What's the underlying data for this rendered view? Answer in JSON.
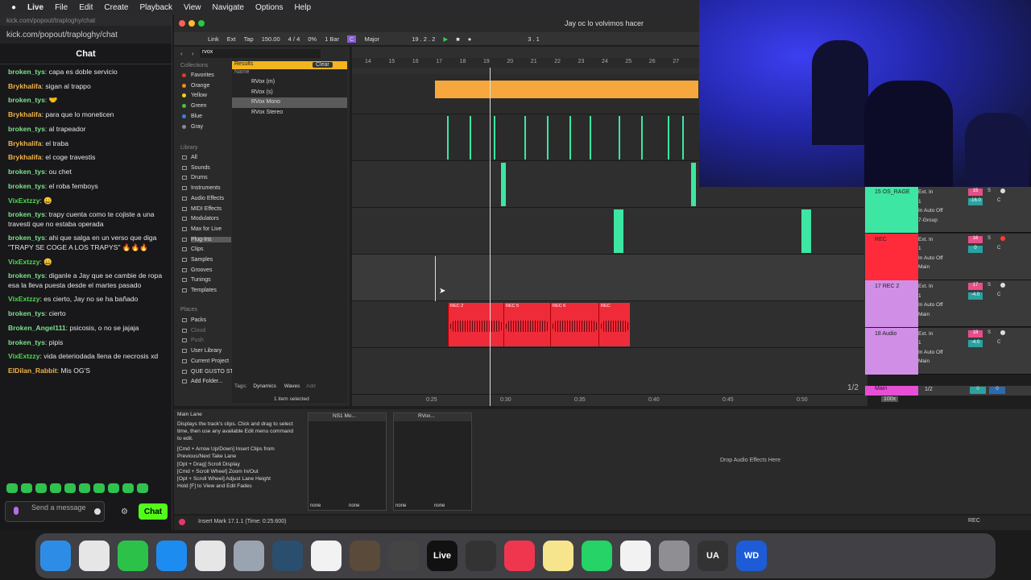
{
  "menubar": {
    "apple": "",
    "app": "Live",
    "items": [
      "File",
      "Edit",
      "Create",
      "Playback",
      "View",
      "Navigate",
      "Options",
      "Help"
    ]
  },
  "chat": {
    "window_title": "kick.com/popout/traploghy/chat",
    "url": "kick.com/popout/traploghy/chat",
    "header": "Chat",
    "messages": [
      {
        "user": "broken_tys",
        "text": "capa es doble servicio",
        "color": "#7ee08a"
      },
      {
        "user": "Brykhalifa",
        "text": "sigan al trappo",
        "color": "#f0b34a"
      },
      {
        "user": "broken_tys",
        "text": "🤝",
        "color": "#7ee08a"
      },
      {
        "user": "Brykhalifa",
        "text": "para que lo moneticen",
        "color": "#f0b34a"
      },
      {
        "user": "broken_tys",
        "text": "al trapeador",
        "color": "#7ee08a"
      },
      {
        "user": "Brykhalifa",
        "text": "el traba",
        "color": "#f0b34a"
      },
      {
        "user": "Brykhalifa",
        "text": "el coge travestis",
        "color": "#f0b34a"
      },
      {
        "user": "broken_tys",
        "text": "ou chet",
        "color": "#7ee08a"
      },
      {
        "user": "broken_tys",
        "text": "el roba femboys",
        "color": "#7ee08a"
      },
      {
        "user": "VixExtzzy",
        "text": "😀",
        "color": "#4fd94f"
      },
      {
        "user": "broken_tys",
        "text": "trapy cuenta como te cojiste a una travesti que no estaba operada",
        "color": "#7ee08a"
      },
      {
        "user": "broken_tys",
        "text": "ahi que salga en un verso que diga \"TRAPY SE COGE A LOS TRAPYS\" 🔥🔥🔥",
        "color": "#7ee08a"
      },
      {
        "user": "VixExtzzy",
        "text": "😀",
        "color": "#4fd94f"
      },
      {
        "user": "broken_tys",
        "text": "diganle a Jay que se cambie de ropa esa la lleva puesta desde el martes pasado",
        "color": "#7ee08a"
      },
      {
        "user": "VixExtzzy",
        "text": "es cierto, Jay no se ha bañado",
        "color": "#4fd94f"
      },
      {
        "user": "broken_tys",
        "text": "cierto",
        "color": "#7ee08a"
      },
      {
        "user": "Broken_Angel111",
        "text": "psicosis, o no se jajaja",
        "color": "#7ee08a"
      },
      {
        "user": "broken_tys",
        "text": "pipis",
        "color": "#7ee08a"
      },
      {
        "user": "VixExtzzy",
        "text": "vida deteriodada llena de necrosis xd",
        "color": "#4fd94f"
      },
      {
        "user": "ElDilan_Rabbit",
        "text": "Mis OG'S",
        "color": "#f0b34a"
      }
    ],
    "send_placeholder": "Send a message",
    "chat_button": "Chat"
  },
  "live": {
    "title": "Jay oc lo volvimos hacer",
    "transport": [
      "Link",
      "Ext",
      "Tap",
      "150.00",
      "4 / 4",
      "0%",
      "1 Bar",
      "C",
      "Major",
      "19 . 2 . 2",
      "3 . 1"
    ],
    "search": "rvox",
    "collections_label": "Collections",
    "collections": [
      {
        "name": "Favorites",
        "color": "#e6372c"
      },
      {
        "name": "Orange",
        "color": "#f28c1e"
      },
      {
        "name": "Yellow",
        "color": "#f2d31e"
      },
      {
        "name": "Green",
        "color": "#49c33a"
      },
      {
        "name": "Blue",
        "color": "#3c7de6"
      },
      {
        "name": "Gray",
        "color": "#8a8a8a"
      }
    ],
    "library_label": "Library",
    "library": [
      "All",
      "Sounds",
      "Drums",
      "Instruments",
      "Audio Effects",
      "MIDI Effects",
      "Modulators",
      "Max for Live",
      "Plug-Ins",
      "Clips",
      "Samples",
      "Grooves",
      "Tunings",
      "Templates"
    ],
    "places_label": "Places",
    "places": [
      "Packs",
      "Cloud",
      "Push",
      "User Library",
      "Current Project",
      "QUE GUSTO ST",
      "Add Folder..."
    ],
    "results_label": "Results",
    "clear_label": "Clear",
    "name_col": "Name",
    "results": [
      "RVox (m)",
      "RVox (s)",
      "RVox Mono",
      "RVox Stereo"
    ],
    "tags_label": "Tags:",
    "tags": [
      "Dynamics",
      "Waves",
      "Add"
    ],
    "selected_status": "1 item selected",
    "ruler": [
      "14",
      "15",
      "16",
      "17",
      "18",
      "19",
      "20",
      "21",
      "22",
      "23",
      "24",
      "25",
      "26",
      "27"
    ],
    "bottom_ruler": [
      "0:25",
      "0:30",
      "0:35",
      "0:40",
      "0:45",
      "0:50"
    ],
    "page_indicator": "1/2",
    "zoom": "100x",
    "tracks": [
      {
        "name": "15 OS_RAGE",
        "color": "#3de6a2",
        "input": "Ext. In",
        "ch": "1",
        "route": "7-Group",
        "num": "15",
        "vol": "-16.0"
      },
      {
        "name": "REC",
        "color": "#ff2a3a",
        "input": "Ext. In",
        "ch": "1",
        "route": "Main",
        "num": "16",
        "vol": "0"
      },
      {
        "name": "17 REC 2",
        "color": "#d08ee6",
        "input": "Ext. In",
        "ch": "1",
        "route": "Main",
        "num": "17",
        "vol": "-4.0"
      },
      {
        "name": "18 Audio",
        "color": "#d08ee6",
        "input": "Ext. In",
        "ch": "1",
        "route": "Main",
        "num": "18",
        "vol": "-4.0"
      }
    ],
    "main_track": {
      "name": "Main",
      "route": "1/2",
      "vol1": "0",
      "vol2": "0"
    },
    "audio_clips": [
      "REC 2",
      "REC 5",
      "REC 6",
      "REC"
    ],
    "detail_title": "Main Lane",
    "detail_text": [
      "Displays the track's clips. Click and drag to select time, then use any available Edit menu command to edit.",
      "[Cmd + Arrow Up/Down] Insert Clips from Previous/Next Take Lane",
      "[Opt + Drag] Scroll Display",
      "[Cmd + Scroll Wheel] Zoom In/Out",
      "[Opt + Scroll Wheel] Adjust Lane Height",
      "Hold [F] to View and Edit Fades"
    ],
    "devices": [
      {
        "name": "NS1 Mo..."
      },
      {
        "name": "RVox..."
      }
    ],
    "device_none": "none",
    "drop_label": "Drop Audio Effects Here",
    "status": "Insert Mark 17.1.1 (Time: 0:25:600)",
    "rec_label": "REC"
  },
  "dock": [
    {
      "name": "finder",
      "label": "",
      "color": "#2d8de6"
    },
    {
      "name": "launchpad",
      "label": "",
      "color": "#e6e6e6"
    },
    {
      "name": "facetime",
      "label": "",
      "color": "#2cc24a"
    },
    {
      "name": "app-store",
      "label": "",
      "color": "#1d8cf0"
    },
    {
      "name": "chrome",
      "label": "",
      "color": "#e6e6e6"
    },
    {
      "name": "app-6",
      "label": "",
      "color": "#9aa4b0"
    },
    {
      "name": "app-7",
      "label": "",
      "color": "#2a4f6e"
    },
    {
      "name": "capcut",
      "label": "",
      "color": "#f2f2f2"
    },
    {
      "name": "fl-studio",
      "label": "",
      "color": "#5a4a3a"
    },
    {
      "name": "app-10",
      "label": "",
      "color": "#444"
    },
    {
      "name": "ableton-live",
      "label": "Live",
      "color": "#111"
    },
    {
      "name": "obs",
      "label": "",
      "color": "#333"
    },
    {
      "name": "music",
      "label": "",
      "color": "#f0364f"
    },
    {
      "name": "notes",
      "label": "",
      "color": "#f6e58d"
    },
    {
      "name": "whatsapp",
      "label": "",
      "color": "#25d366"
    },
    {
      "name": "chatgpt",
      "label": "",
      "color": "#f2f2f2"
    },
    {
      "name": "system-settings",
      "label": "",
      "color": "#8e8e93"
    },
    {
      "name": "universal-audio",
      "label": "UA",
      "color": "#333"
    },
    {
      "name": "wd",
      "label": "WD",
      "color": "#1e5bd6"
    }
  ]
}
